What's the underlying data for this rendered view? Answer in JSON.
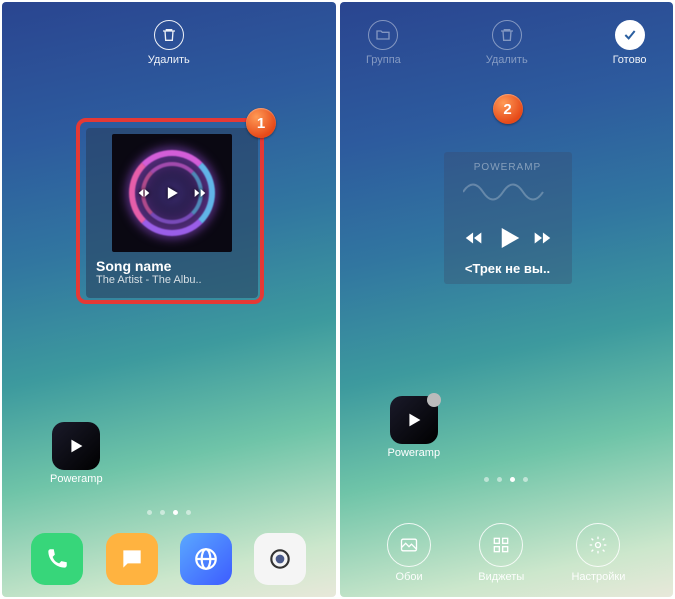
{
  "steps": {
    "one": "1",
    "two": "2"
  },
  "panel1": {
    "top": {
      "delete": "Удалить"
    },
    "widget": {
      "song": "Song name",
      "artist": "The Artist - The Albu.."
    },
    "app": {
      "poweramp": "Poweramp"
    }
  },
  "panel2": {
    "top": {
      "group": "Группа",
      "delete": "Удалить",
      "done": "Готово"
    },
    "widget": {
      "brand": "POWERAMP",
      "track": "<Трек не вы.."
    },
    "app": {
      "poweramp": "Poweramp"
    },
    "dock": {
      "wallpaper": "Обои",
      "widgets": "Виджеты",
      "settings": "Настройки"
    }
  }
}
